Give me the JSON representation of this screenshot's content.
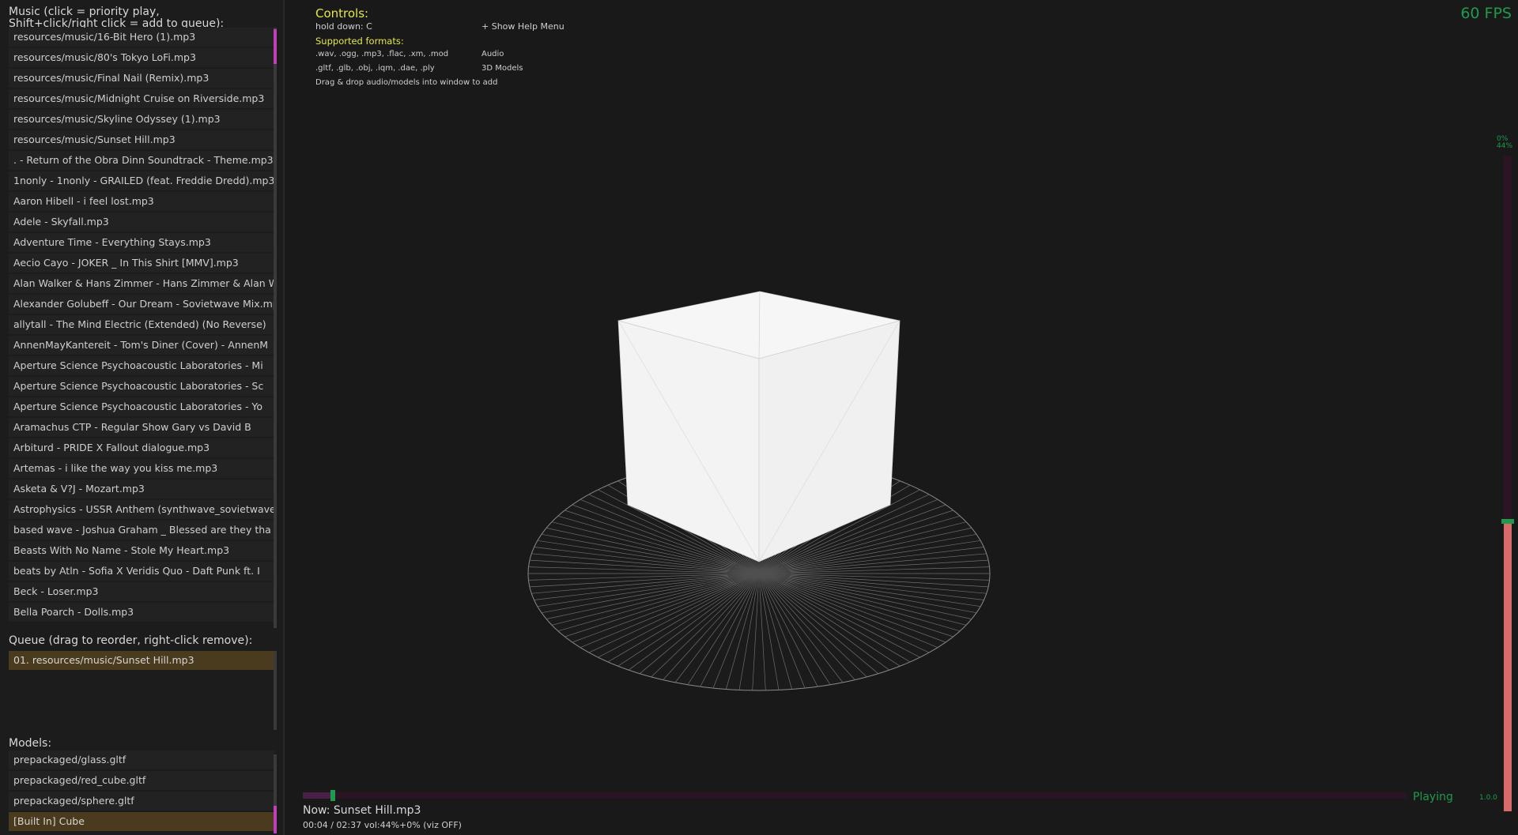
{
  "music": {
    "header_line1": "Music (click = priority play,",
    "header_line2": "Shift+click/right click = add to queue):",
    "items": [
      "resources/music/16-Bit Hero (1).mp3",
      "resources/music/80's Tokyo LoFi.mp3",
      "resources/music/Final Nail (Remix).mp3",
      "resources/music/Midnight Cruise on Riverside.mp3",
      "resources/music/Skyline Odyssey (1).mp3",
      "resources/music/Sunset Hill.mp3",
      ". - Return of the Obra Dinn Soundtrack - Theme.mp3",
      "1nonly - 1nonly - GRAILED (feat. Freddie Dredd).mp3",
      "Aaron Hibell - i feel lost.mp3",
      "Adele - Skyfall.mp3",
      "Adventure Time - Everything Stays.mp3",
      "Aecio Cayo - JOKER _ In This Shirt [MMV].mp3",
      "Alan Walker & Hans Zimmer - Hans Zimmer & Alan Wa",
      "Alexander Golubeff - Our Dream - Sovietwave Mix.mp",
      "allytall - The Mind Electric (Extended) (No Reverse)",
      "AnnenMayKantereit - Tom's Diner (Cover) - AnnenM",
      "Aperture Science Psychoacoustic Laboratories - Mi",
      "Aperture Science Psychoacoustic Laboratories - Sc",
      "Aperture Science Psychoacoustic Laboratories - Yo",
      "Aramachus CTP - Regular Show   Gary vs David   B",
      "Arbiturd - PRIDE X Fallout dialogue.mp3",
      "Artemas - i like the way you kiss me.mp3",
      "Asketa & V?J - Mozart.mp3",
      "Astrophysics - USSR Anthem (synthwave_sovietwave",
      "based wave - Joshua Graham _ Blessed are they tha",
      "Beasts With No Name - Stole My Heart.mp3",
      "beats by Atln - Sofia X Veridis Quo - Daft Punk ft. I",
      "Beck - Loser.mp3",
      "Bella Poarch - Dolls.mp3"
    ]
  },
  "queue": {
    "header": "Queue (drag to reorder, right-click remove):",
    "items": [
      "01. resources/music/Sunset Hill.mp3"
    ]
  },
  "models": {
    "header": "Models:",
    "items": [
      "prepackaged/glass.gltf",
      "prepackaged/red_cube.gltf",
      "prepackaged/sphere.gltf",
      "[Built In] Cube"
    ],
    "selected_index": 3
  },
  "controls": {
    "title": "Controls:",
    "hold_key": "hold down: C",
    "hold_action": "+ Show Help Menu",
    "formats_title": "Supported formats:",
    "audio_ext": ".wav, .ogg, .mp3, .flac, .xm, .mod",
    "audio_label": "Audio",
    "model_ext": ".gltf, .glb, .obj, .iqm, .dae, .ply",
    "model_label": "3D Models",
    "dragdrop": "Drag & drop audio/models into window to add"
  },
  "fps": "60 FPS",
  "volume_meter": {
    "top_label": "0%",
    "top_label2": "44%",
    "level_percent": 44
  },
  "playback": {
    "status": "Playing",
    "status_value": "1.0.0",
    "now_playing": "Now: Sunset Hill.mp3",
    "info": "00:04 / 02:37   vol:44%+0%  (viz OFF)",
    "progress_fraction": 0.025
  },
  "colors": {
    "accent_green": "#1f9a4e",
    "highlight_amber": "#4a3a1e",
    "title_yellow": "#e5e64a",
    "meter_red": "#d86a6a",
    "scroll_pink": "#c040b8"
  }
}
